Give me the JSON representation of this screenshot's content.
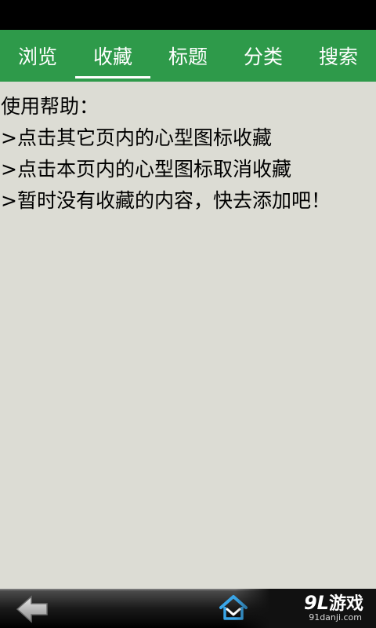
{
  "tabs": [
    {
      "label": "浏览",
      "active": false
    },
    {
      "label": "收藏",
      "active": true
    },
    {
      "label": "标题",
      "active": false
    },
    {
      "label": "分类",
      "active": false
    },
    {
      "label": "搜索",
      "active": false
    }
  ],
  "help": {
    "title": "使用帮助：",
    "lines": [
      ">点击其它页内的心型图标收藏",
      ">点击本页内的心型图标取消收藏",
      ">暂时没有收藏的内容，快去添加吧！"
    ]
  },
  "navigation": {
    "back_icon": "back-arrow-icon",
    "home_icon": "home-icon"
  },
  "watermark": {
    "logo_number": "9L",
    "logo_text": "游戏",
    "domain": "91danji.com"
  },
  "colors": {
    "tab_bar": "#2e9a4a",
    "content_background": "#dcdcd4",
    "status_bar": "#000000"
  }
}
